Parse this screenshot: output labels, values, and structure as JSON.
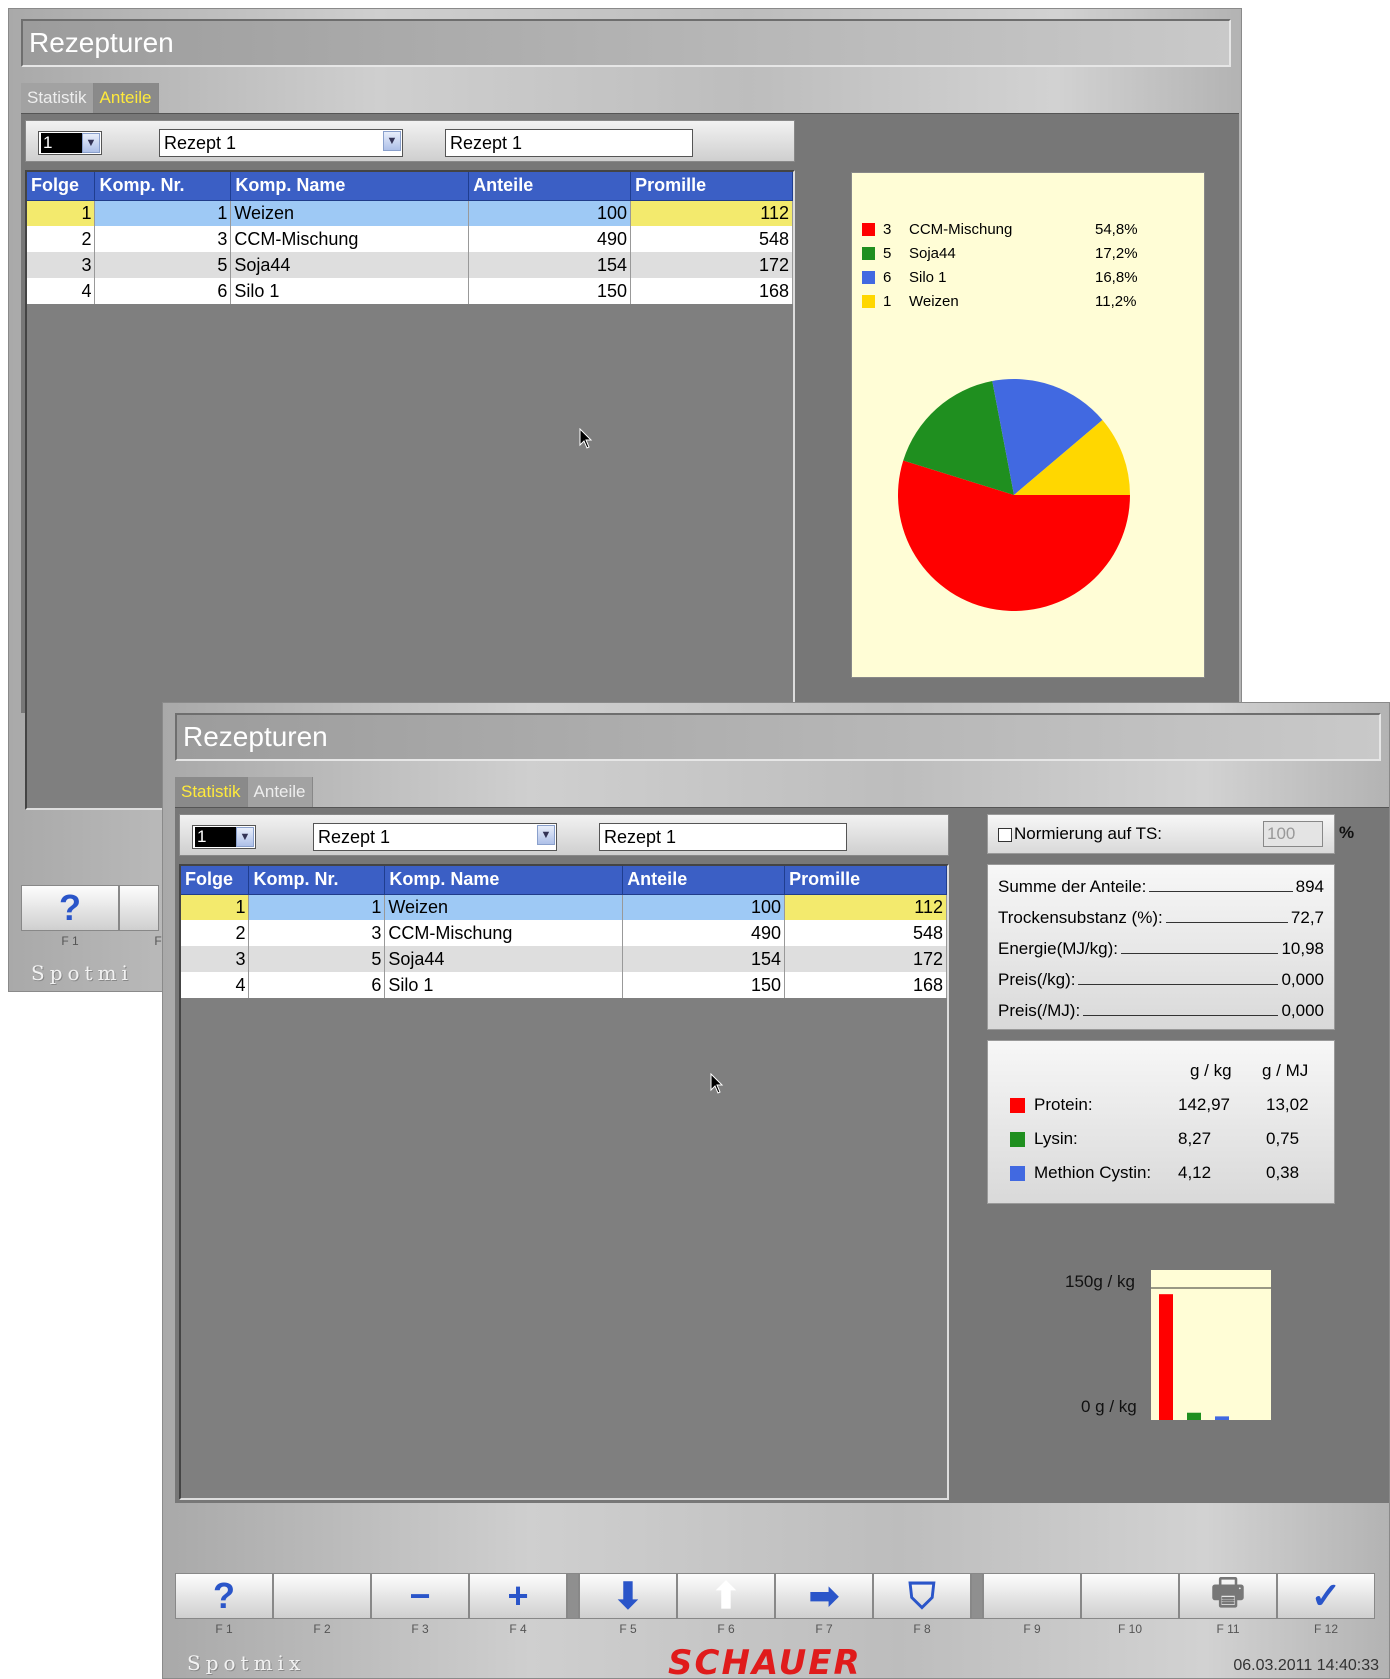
{
  "back_window": {
    "title": "Rezepturen",
    "tabs": [
      {
        "label": "Statistik"
      },
      {
        "label": "Anteile"
      }
    ],
    "active_tab": "Anteile",
    "toolbar": {
      "number_value": "1",
      "recipe_select": "Rezept 1",
      "recipe_name": "Rezept 1"
    },
    "fkey": {
      "label": "?",
      "key": "F 1",
      "key2": "F"
    },
    "brand": "Spotmi"
  },
  "front_window": {
    "title": "Rezepturen",
    "tabs": [
      {
        "label": "Statistik"
      },
      {
        "label": "Anteile"
      }
    ],
    "active_tab": "Statistik",
    "toolbar": {
      "number_value": "1",
      "recipe_select": "Rezept 1",
      "recipe_name": "Rezept 1"
    },
    "normierung": {
      "label": "Normierung auf TS:",
      "value": "100",
      "unit": "%",
      "checked": false
    },
    "summary": [
      {
        "label": "Summe der Anteile:",
        "value": "894"
      },
      {
        "label": "Trockensubstanz (%):",
        "value": "72,7"
      },
      {
        "label": "Energie(MJ/kg):",
        "value": "10,98"
      },
      {
        "label": "Preis(/kg):",
        "value": "0,000"
      },
      {
        "label": "Preis(/MJ):",
        "value": "0,000"
      }
    ],
    "nutrients_header": {
      "col1": "g / kg",
      "col2": "g / MJ"
    },
    "nutrients": [
      {
        "label": "Protein:",
        "gkg": "142,97",
        "gmj": "13,02",
        "color": "#ff0000"
      },
      {
        "label": "Lysin:",
        "gkg": "8,27",
        "gmj": "0,75",
        "color": "#1f8f1f"
      },
      {
        "label": "Methion Cystin:",
        "gkg": "4,12",
        "gmj": "0,38",
        "color": "#4169e1"
      }
    ],
    "fkeys": [
      {
        "key": "F 1",
        "icon": "help-icon",
        "glyph": "?"
      },
      {
        "key": "F 2",
        "icon": "",
        "glyph": ""
      },
      {
        "key": "F 3",
        "icon": "minus-icon",
        "glyph": "−"
      },
      {
        "key": "F 4",
        "icon": "plus-icon",
        "glyph": "+"
      },
      {
        "key": "F 5",
        "icon": "arrow-down-icon",
        "glyph": "⬇"
      },
      {
        "key": "F 6",
        "icon": "arrow-up-icon",
        "glyph": "⬆"
      },
      {
        "key": "F 7",
        "icon": "arrow-right-icon",
        "glyph": "➡"
      },
      {
        "key": "F 8",
        "icon": "hopper-icon",
        "glyph": "⛉"
      },
      {
        "key": "F 9",
        "icon": "",
        "glyph": ""
      },
      {
        "key": "F 10",
        "icon": "",
        "glyph": ""
      },
      {
        "key": "F 11",
        "icon": "printer-icon",
        "glyph": "🖶"
      },
      {
        "key": "F 12",
        "icon": "check-icon",
        "glyph": "✓"
      }
    ],
    "brand_left": "Spotmix",
    "brand_center": "SCHAUER",
    "datetime": "06.03.2011 14:40:33"
  },
  "table": {
    "columns": [
      "Folge",
      "Komp. Nr.",
      "Komp. Name",
      "Anteile",
      "Promille"
    ],
    "rows": [
      {
        "folge": "1",
        "nr": "1",
        "name": "Weizen",
        "anteile": "100",
        "promille": "112"
      },
      {
        "folge": "2",
        "nr": "3",
        "name": "CCM-Mischung",
        "anteile": "490",
        "promille": "548"
      },
      {
        "folge": "3",
        "nr": "5",
        "name": "Soja44",
        "anteile": "154",
        "promille": "172"
      },
      {
        "folge": "4",
        "nr": "6",
        "name": "Silo 1",
        "anteile": "150",
        "promille": "168"
      }
    ]
  },
  "chart_data": [
    {
      "type": "pie",
      "slices": [
        {
          "nr": "3",
          "name": "CCM-Mischung",
          "value": 54.8,
          "label": "54,8%",
          "color": "#ff0000"
        },
        {
          "nr": "5",
          "name": "Soja44",
          "value": 17.2,
          "label": "17,2%",
          "color": "#1f8f1f"
        },
        {
          "nr": "6",
          "name": "Silo 1",
          "value": 16.8,
          "label": "16,8%",
          "color": "#4169e1"
        },
        {
          "nr": "1",
          "name": "Weizen",
          "value": 11.2,
          "label": "11,2%",
          "color": "#ffd700"
        }
      ]
    },
    {
      "type": "bar",
      "ylim": [
        0,
        150
      ],
      "ytick_top": "150g / kg",
      "ytick_bottom": "0 g / kg",
      "categories": [
        "Protein",
        "Lysin",
        "Methion Cystin"
      ],
      "values": [
        142.97,
        8.27,
        4.12
      ],
      "colors": [
        "#ff0000",
        "#1f8f1f",
        "#4169e1"
      ]
    }
  ]
}
